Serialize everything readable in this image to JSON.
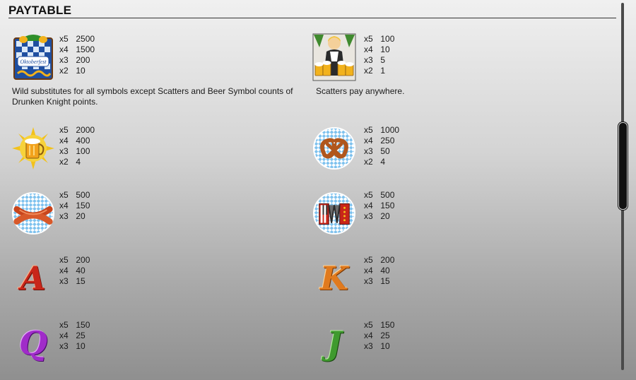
{
  "header": {
    "title": "PAYTABLE"
  },
  "notes": {
    "wild": "Wild substitutes for all symbols except Scatters and Beer Symbol counts of Drunken Knight points.",
    "scatter": "Scatters pay anywhere.",
    "wild_logo_text": "Oktoberfest"
  },
  "symbols": [
    {
      "icon": "wild-oktoberfest-sign-icon",
      "pays": [
        [
          "x5",
          "2500"
        ],
        [
          "x4",
          "1500"
        ],
        [
          "x3",
          "200"
        ],
        [
          "x2",
          "10"
        ]
      ]
    },
    {
      "icon": "scatter-beer-maid-icon",
      "pays": [
        [
          "x5",
          "100"
        ],
        [
          "x4",
          "10"
        ],
        [
          "x3",
          "5"
        ],
        [
          "x2",
          "1"
        ]
      ]
    },
    {
      "icon": "beer-mug-sun-icon",
      "pays": [
        [
          "x5",
          "2000"
        ],
        [
          "x4",
          "400"
        ],
        [
          "x3",
          "100"
        ],
        [
          "x2",
          "4"
        ]
      ]
    },
    {
      "icon": "pretzel-icon",
      "pays": [
        [
          "x5",
          "1000"
        ],
        [
          "x4",
          "250"
        ],
        [
          "x3",
          "50"
        ],
        [
          "x2",
          "4"
        ]
      ]
    },
    {
      "icon": "sausages-icon",
      "pays": [
        [
          "x5",
          "500"
        ],
        [
          "x4",
          "150"
        ],
        [
          "x3",
          "20"
        ]
      ]
    },
    {
      "icon": "accordion-icon",
      "pays": [
        [
          "x5",
          "500"
        ],
        [
          "x4",
          "150"
        ],
        [
          "x3",
          "20"
        ]
      ]
    },
    {
      "icon": "letter-a-icon",
      "letter": "A",
      "pays": [
        [
          "x5",
          "200"
        ],
        [
          "x4",
          "40"
        ],
        [
          "x3",
          "15"
        ]
      ]
    },
    {
      "icon": "letter-k-icon",
      "letter": "K",
      "pays": [
        [
          "x5",
          "200"
        ],
        [
          "x4",
          "40"
        ],
        [
          "x3",
          "15"
        ]
      ]
    },
    {
      "icon": "letter-q-icon",
      "letter": "Q",
      "pays": [
        [
          "x5",
          "150"
        ],
        [
          "x4",
          "25"
        ],
        [
          "x3",
          "10"
        ]
      ]
    },
    {
      "icon": "letter-j-icon",
      "letter": "J",
      "pays": [
        [
          "x5",
          "150"
        ],
        [
          "x4",
          "25"
        ],
        [
          "x3",
          "10"
        ]
      ]
    }
  ],
  "colors": {
    "letter_a": "#c8261a",
    "letter_k": "#e07a1e",
    "letter_q": "#a02cc9",
    "letter_j": "#3f9a2e",
    "bavarian_blue": "#3d8fd8",
    "beer_gold": "#f2b21c"
  }
}
